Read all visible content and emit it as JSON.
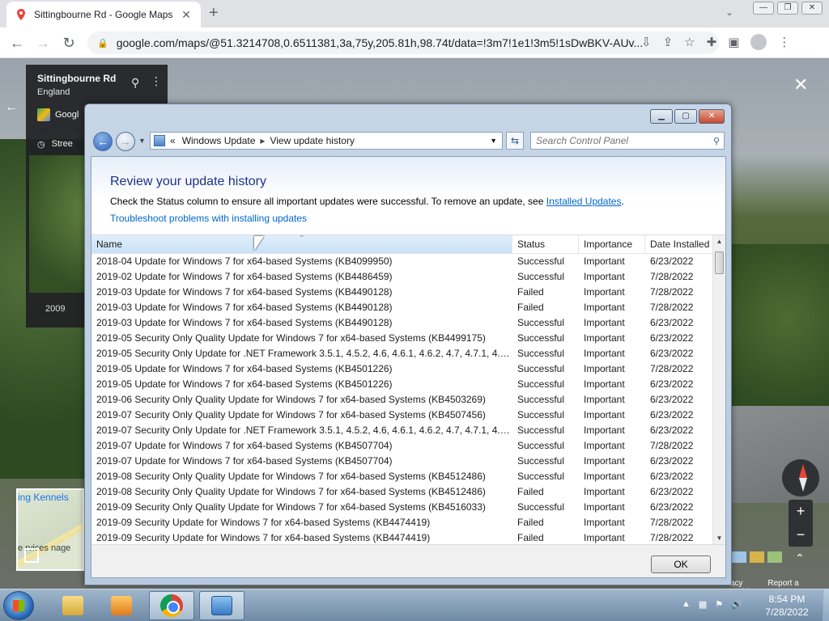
{
  "browser": {
    "tab_title": "Sittingbourne Rd - Google Maps",
    "tab_close": "✕",
    "new_tab": "+",
    "tabs_menu": "⌄",
    "url": "google.com/maps/@51.3214708,0.6511381,3a,75y,205.81h,98.74t/data=!3m7!1e1!3m5!1sDwBKV-AUv...",
    "win_min": "—",
    "win_max": "❐",
    "win_close": "✕"
  },
  "streetview": {
    "place_title": "Sittingbourne Rd",
    "place_sub": "England",
    "google_label": "Googl",
    "street_label": "Stree",
    "year": "2009",
    "minimap_label1": "ing Kennels",
    "minimap_label2": "e rvices\nnage",
    "footer_privacy": "acy",
    "footer_report": "Report a problem"
  },
  "dialog": {
    "breadcrumb_prefix": "«",
    "breadcrumb": [
      "Windows Update",
      "View update history"
    ],
    "search_placeholder": "Search Control Panel",
    "title": "Review your update history",
    "description": "Check the Status column to ensure all important updates were successful. To remove an update, see ",
    "installed_updates_link": "Installed Updates",
    "description_end": ".",
    "troubleshoot_link": "Troubleshoot problems with installing updates",
    "columns": {
      "name": "Name",
      "status": "Status",
      "importance": "Importance",
      "date": "Date Installed"
    },
    "rows": [
      {
        "name": "2018-04 Update for Windows 7 for x64-based Systems (KB4099950)",
        "status": "Successful",
        "importance": "Important",
        "date": "6/23/2022"
      },
      {
        "name": "2019-02 Update for Windows 7 for x64-based Systems (KB4486459)",
        "status": "Successful",
        "importance": "Important",
        "date": "7/28/2022"
      },
      {
        "name": "2019-03 Update for Windows 7 for x64-based Systems (KB4490128)",
        "status": "Failed",
        "importance": "Important",
        "date": "7/28/2022"
      },
      {
        "name": "2019-03 Update for Windows 7 for x64-based Systems (KB4490128)",
        "status": "Failed",
        "importance": "Important",
        "date": "7/28/2022"
      },
      {
        "name": "2019-03 Update for Windows 7 for x64-based Systems (KB4490128)",
        "status": "Successful",
        "importance": "Important",
        "date": "6/23/2022"
      },
      {
        "name": "2019-05 Security Only Quality Update for Windows 7 for x64-based Systems (KB4499175)",
        "status": "Successful",
        "importance": "Important",
        "date": "6/23/2022"
      },
      {
        "name": "2019-05 Security Only Update for .NET Framework 3.5.1, 4.5.2, 4.6, 4.6.1, 4.6.2, 4.7, 4.7.1, 4.7.2, 4.8...",
        "status": "Successful",
        "importance": "Important",
        "date": "6/23/2022"
      },
      {
        "name": "2019-05 Update for Windows 7 for x64-based Systems (KB4501226)",
        "status": "Successful",
        "importance": "Important",
        "date": "7/28/2022"
      },
      {
        "name": "2019-05 Update for Windows 7 for x64-based Systems (KB4501226)",
        "status": "Successful",
        "importance": "Important",
        "date": "6/23/2022"
      },
      {
        "name": "2019-06 Security Only Quality Update for Windows 7 for x64-based Systems (KB4503269)",
        "status": "Successful",
        "importance": "Important",
        "date": "6/23/2022"
      },
      {
        "name": "2019-07 Security Only Quality Update for Windows 7 for x64-based Systems (KB4507456)",
        "status": "Successful",
        "importance": "Important",
        "date": "6/23/2022"
      },
      {
        "name": "2019-07 Security Only Update for .NET Framework 3.5.1, 4.5.2, 4.6, 4.6.1, 4.6.2, 4.7, 4.7.1, 4.7.2, 4.8...",
        "status": "Successful",
        "importance": "Important",
        "date": "6/23/2022"
      },
      {
        "name": "2019-07 Update for Windows 7 for x64-based Systems (KB4507704)",
        "status": "Successful",
        "importance": "Important",
        "date": "7/28/2022"
      },
      {
        "name": "2019-07 Update for Windows 7 for x64-based Systems (KB4507704)",
        "status": "Successful",
        "importance": "Important",
        "date": "6/23/2022"
      },
      {
        "name": "2019-08 Security Only Quality Update for Windows 7 for x64-based Systems (KB4512486)",
        "status": "Successful",
        "importance": "Important",
        "date": "6/23/2022"
      },
      {
        "name": "2019-08 Security Only Quality Update for Windows 7 for x64-based Systems (KB4512486)",
        "status": "Failed",
        "importance": "Important",
        "date": "6/23/2022"
      },
      {
        "name": "2019-09 Security Only Quality Update for Windows 7 for x64-based Systems (KB4516033)",
        "status": "Successful",
        "importance": "Important",
        "date": "6/23/2022"
      },
      {
        "name": "2019-09 Security Update for Windows 7 for x64-based Systems (KB4474419)",
        "status": "Failed",
        "importance": "Important",
        "date": "7/28/2022"
      },
      {
        "name": "2019-09 Security Update for Windows 7 for x64-based Systems (KB4474419)",
        "status": "Failed",
        "importance": "Important",
        "date": "7/28/2022"
      }
    ],
    "ok_label": "OK"
  },
  "taskbar": {
    "time": "8:54 PM",
    "date": "7/28/2022"
  }
}
